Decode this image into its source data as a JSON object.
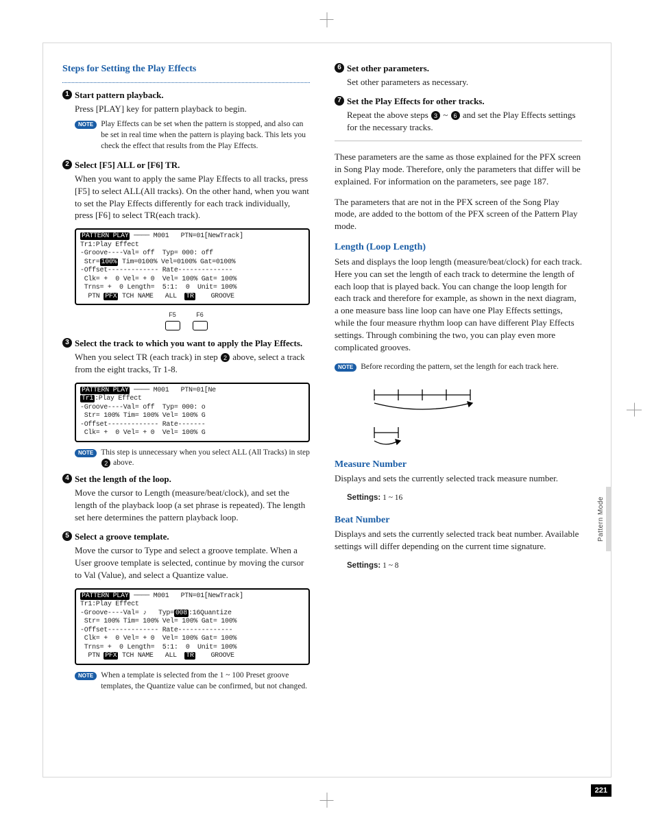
{
  "sectionTitle": "Steps for Setting the Play Effects",
  "steps": {
    "s1": {
      "num": "1",
      "title": "Start pattern playback.",
      "body": "Press [PLAY] key for pattern playback to begin.",
      "note": "Play Effects can be set when the pattern is stopped, and also can be set in real time when the pattern is playing back. This lets you check the effect that results from the Play Effects."
    },
    "s2": {
      "num": "2",
      "title": "Select [F5] ALL or [F6] TR.",
      "body": "When you want to apply the same Play Effects to all tracks, press [F5] to select ALL(All tracks). On the other hand, when you want to set the Play Effects differently for each track individually, press [F6] to select TR(each track)."
    },
    "s3": {
      "num": "3",
      "title": "Select the track to which you want to apply the Play Effects.",
      "body": "When you select TR (each track) in step 2 above, select a track from the eight tracks, Tr 1-8.",
      "note": "This step is unnecessary when you select ALL (All Tracks) in step 2 above."
    },
    "s4": {
      "num": "4",
      "title": "Set the length of the loop.",
      "body": "Move the cursor to Length (measure/beat/clock), and set the length of the playback loop (a set phrase is repeated). The length set here determines the pattern playback loop."
    },
    "s5": {
      "num": "5",
      "title": "Select a groove template.",
      "body": "Move the cursor to Type and select a groove template. When a User groove template is selected, continue by moving the cursor to Val (Value), and select a Quantize value.",
      "note": "When a template is selected from the 1 ~ 100 Preset groove templates, the Quantize value can be confirmed, but not changed."
    },
    "s6": {
      "num": "6",
      "title": "Set other parameters.",
      "body": "Set other parameters as necessary."
    },
    "s7": {
      "num": "7",
      "title": "Set the Play Effects for other tracks.",
      "body": "Repeat the above steps 3 ~ 6 and set the Play Effects settings for the necessary tracks."
    }
  },
  "lcd1": {
    "l1a": "PATTERN PLAY",
    "l1b": "M001",
    "l1c": "PTN=01[NewTrack]",
    "l2": "Tr1:Play Effect",
    "l3": "-Groove----Val= off  Typ= 000: off",
    "l4a": " Str=",
    "l4b": "100%",
    "l4c": " Tim=0100% Vel=0100% Gat=0100%",
    "l5": "-Offset------------- Rate--------------",
    "l6": " Clk= +  0 Vel= + 0  Vel= 100% Gat= 100%",
    "l7": " Trns= +  0 Length=  5:1:  0  Unit= 100%",
    "l8a": "  PTN ",
    "l8b": "PFX",
    "l8c": " TCH NAME   ALL  ",
    "l8d": "TR",
    "l8e": "    GROOVE"
  },
  "fkeys": {
    "f5": "F5",
    "f6": "F6"
  },
  "lcd2": {
    "l1a": "PATTERN PLAY",
    "l1b": "M001",
    "l1c": "PTN=01[Ne",
    "l2a": "Tr1",
    "l2b": ":Play Effect",
    "l3": "-Groove----Val= off  Typ= 000: o",
    "l4": " Str= 100% Tim= 100% Vel= 100% G",
    "l5": "-Offset------------- Rate-------",
    "l6": " Clk= +  0 Vel= + 0  Vel= 100% G"
  },
  "lcd3": {
    "l1a": "PATTERN PLAY",
    "l1b": "M001",
    "l1c": "PTN=01[NewTrack]",
    "l2": "Tr1:Play Effect",
    "l3a": "-Groove----Val= ♪   Typ=",
    "l3b": "008",
    "l3c": ":16Quantize",
    "l4": " Str= 100% Tim= 100% Vel= 100% Gat= 100%",
    "l5": "-Offset------------- Rate--------------",
    "l6": " Clk= +  0 Vel= + 0  Vel= 100% Gat= 100%",
    "l7": " Trns= +  0 Length=  5:1:  0  Unit= 100%",
    "l8a": "  PTN ",
    "l8b": "PFX",
    "l8c": " TCH NAME   ALL  ",
    "l8d": "TR",
    "l8e": "    GROOVE"
  },
  "right": {
    "p1": "These parameters are the same as those explained for the PFX screen in Song Play mode. Therefore, only the parameters that differ will be explained. For information on the parameters, see page 187.",
    "p2": "The parameters that are not in the PFX screen of the Song Play mode, are added to the bottom of the PFX screen of the Pattern Play mode.",
    "length_h": "Length (Loop Length)",
    "length_b": "Sets and displays the loop length (measure/beat/clock) for each track. Here you can set the length of each track to determine the length of each loop that is played back. You can change the loop length for each track and therefore for example, as shown in the next diagram, a one measure bass line loop can have one Play Effects settings, while the four measure rhythm loop can have different Play Effects settings. Through combining the two, you can play even more complicated grooves.",
    "length_note": "Before recording the pattern, set the length for each track here.",
    "measure_h": "Measure Number",
    "measure_b": "Displays and sets the currently selected track measure number.",
    "measure_set_l": "Settings:",
    "measure_set_v": " 1 ~ 16",
    "beat_h": "Beat Number",
    "beat_b": "Displays and sets the currently selected track beat number. Available settings will differ depending on the current time signature.",
    "beat_set_l": "Settings:",
    "beat_set_v": " 1 ~ 8"
  },
  "sideTab": "Pattern Mode",
  "pageNum": "221",
  "noteLabel": "NOTE"
}
